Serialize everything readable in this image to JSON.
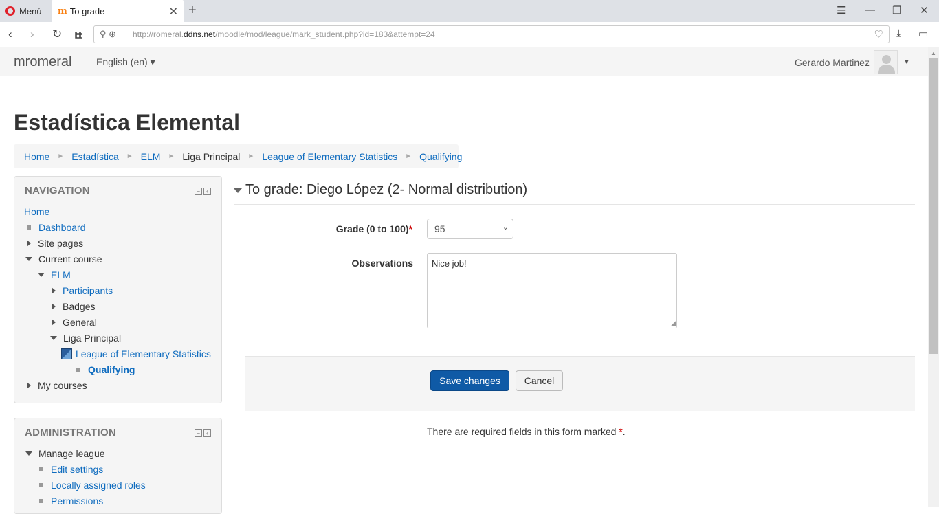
{
  "browser": {
    "menu_label": "Menú",
    "tab_title": "To grade",
    "url_prefix": "http://romeral.",
    "url_domain": "ddns.net",
    "url_path": "/moodle/mod/league/mark_student.php?id=183&attempt=24"
  },
  "header": {
    "brand": "mromeral",
    "language": "English (en) ▾",
    "user_name": "Gerardo Martinez"
  },
  "page": {
    "title": "Estadística Elemental"
  },
  "breadcrumb": [
    "Home",
    "Estadística",
    "ELM",
    "Liga Principal",
    "League of Elementary Statistics",
    "Qualifying"
  ],
  "navigation": {
    "title": "NAVIGATION",
    "items": [
      {
        "label": "Home"
      },
      {
        "label": "Dashboard"
      },
      {
        "label": "Site pages"
      },
      {
        "label": "Current course"
      },
      {
        "label": "ELM"
      },
      {
        "label": "Participants"
      },
      {
        "label": "Badges"
      },
      {
        "label": "General"
      },
      {
        "label": "Liga Principal"
      },
      {
        "label": "League of Elementary Statistics"
      },
      {
        "label": "Qualifying"
      },
      {
        "label": "My courses"
      }
    ]
  },
  "administration": {
    "title": "ADMINISTRATION",
    "items": [
      {
        "label": "Manage league"
      },
      {
        "label": "Edit settings"
      },
      {
        "label": "Locally assigned roles"
      },
      {
        "label": "Permissions"
      }
    ]
  },
  "form": {
    "legend": "To grade: Diego López (2- Normal distribution)",
    "grade_label": "Grade (0 to 100)",
    "required_mark": "*",
    "grade_value": "95",
    "observations_label": "Observations",
    "observations_value": "Nice job!",
    "save_label": "Save changes",
    "cancel_label": "Cancel",
    "required_note": "There are required fields in this form marked",
    "required_note_end": "."
  },
  "colors": {
    "link": "#0f6cbf",
    "primary_button": "#0f5aa6",
    "required": "#cc0000"
  }
}
